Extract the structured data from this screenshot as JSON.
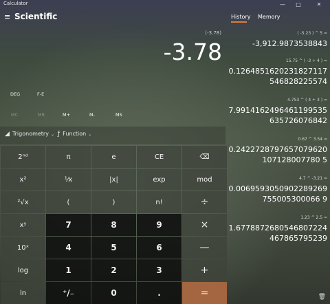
{
  "window": {
    "title": "Calculator",
    "minimize": "—",
    "maximize": "□",
    "close": "✕"
  },
  "header": {
    "menu_icon": "≡",
    "mode": "Scientific"
  },
  "display": {
    "expression": "(-3.78)",
    "value": "-3.78"
  },
  "modes": {
    "angle": "DEG",
    "fe": "F-E"
  },
  "memory_buttons": [
    "MC",
    "MR",
    "M+",
    "M-",
    "MS"
  ],
  "toolbar": {
    "trig_icon": "◢",
    "trig_label": "Trigonometry",
    "func_icon": "ƒ",
    "func_label": "Function",
    "chevron": "⌄"
  },
  "keys": [
    [
      "2ⁿᵈ",
      "π",
      "e",
      "CE",
      "⌫"
    ],
    [
      "x²",
      "¹⁄x",
      "|x|",
      "exp",
      "mod"
    ],
    [
      "²√x",
      "(",
      ")",
      "n!",
      "÷"
    ],
    [
      "xʸ",
      "7",
      "8",
      "9",
      "×"
    ],
    [
      "10ˣ",
      "4",
      "5",
      "6",
      "—"
    ],
    [
      "log",
      "1",
      "2",
      "3",
      "+"
    ],
    [
      "ln",
      "⁺/₋",
      "0",
      ".",
      "="
    ]
  ],
  "tabs": [
    "History",
    "Memory"
  ],
  "history": [
    {
      "expr": "( -5.23 )  ^  5 =",
      "result": "-3,912.9873538843"
    },
    {
      "expr": "15.75  ^  ( -3  ÷  4 ) =",
      "result": "0.1264851620231827117546828225574"
    },
    {
      "expr": "4.753  ^  ( 4  ÷  3 ) =",
      "result": "7.9914162496461199535635726076842"
    },
    {
      "expr": "0.67  ^  3.54 =",
      "result": "0.2422728797657079620107128007780 5"
    },
    {
      "expr": "4.7  ^  -3.21 =",
      "result": "0.0069593050902289269755005300066 9"
    },
    {
      "expr": "1.23  ^  2.5 =",
      "result": "1.6778872680546807224467865795239"
    }
  ],
  "trash_icon": "🗑"
}
